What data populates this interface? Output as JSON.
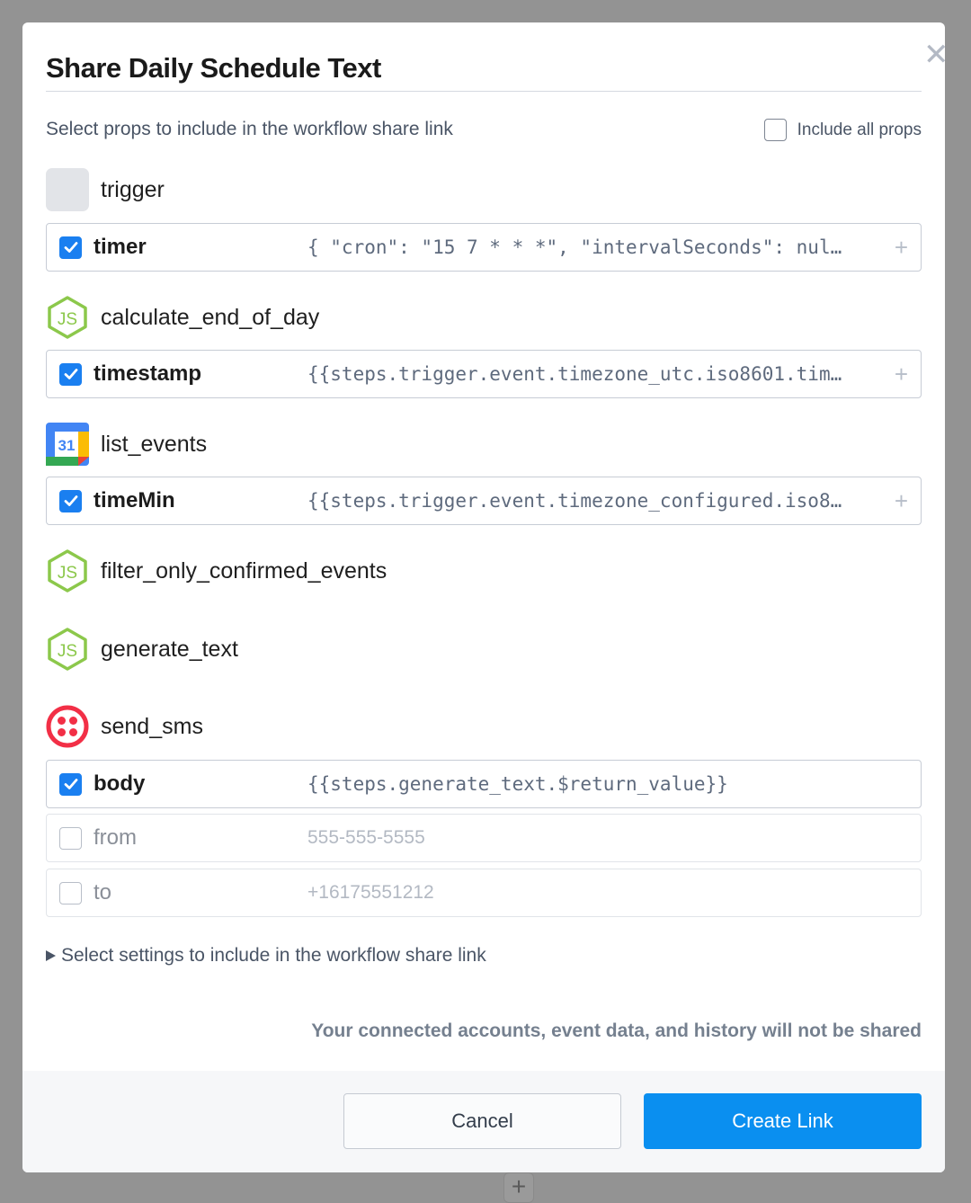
{
  "dialog": {
    "title": "Share Daily Schedule Text",
    "close_icon": "close-icon",
    "subhead": "Select props to include in the workflow share link",
    "include_all_label": "Include all props",
    "include_all_checked": false
  },
  "steps": [
    {
      "name": "trigger",
      "icon": "trigger-placeholder-icon",
      "props": [
        {
          "name": "timer",
          "value": "{ \"cron\": \"15 7 * * *\", \"intervalSeconds\": nul…",
          "checked": true,
          "has_add": true
        }
      ]
    },
    {
      "name": "calculate_end_of_day",
      "icon": "nodejs-icon",
      "props": [
        {
          "name": "timestamp",
          "value": "{{steps.trigger.event.timezone_utc.iso8601.tim…",
          "checked": true,
          "has_add": true
        }
      ]
    },
    {
      "name": "list_events",
      "icon": "google-calendar-icon",
      "calendar_day": "31",
      "props": [
        {
          "name": "timeMin",
          "value": "{{steps.trigger.event.timezone_configured.iso8…",
          "checked": true,
          "has_add": true
        }
      ]
    },
    {
      "name": "filter_only_confirmed_events",
      "icon": "nodejs-icon",
      "props": []
    },
    {
      "name": "generate_text",
      "icon": "nodejs-icon",
      "props": []
    },
    {
      "name": "send_sms",
      "icon": "twilio-icon",
      "props": [
        {
          "name": "body",
          "value": "{{steps.generate_text.$return_value}}",
          "checked": true,
          "has_add": false
        },
        {
          "name": "from",
          "value": "555-555-5555",
          "checked": false,
          "has_add": false
        },
        {
          "name": "to",
          "value": "+16175551212",
          "checked": false,
          "has_add": false
        }
      ]
    }
  ],
  "settings_toggle": "Select settings to include in the workflow share link",
  "notice": "Your connected accounts, event data, and history will not be shared",
  "buttons": {
    "cancel": "Cancel",
    "create": "Create Link"
  },
  "add_glyph": "+",
  "close_glyph": "✕",
  "colors": {
    "accent": "#0a8ff0",
    "checkbox": "#1a7ff0",
    "nodejs": "#8cc84b",
    "twilio": "#f22f46"
  }
}
